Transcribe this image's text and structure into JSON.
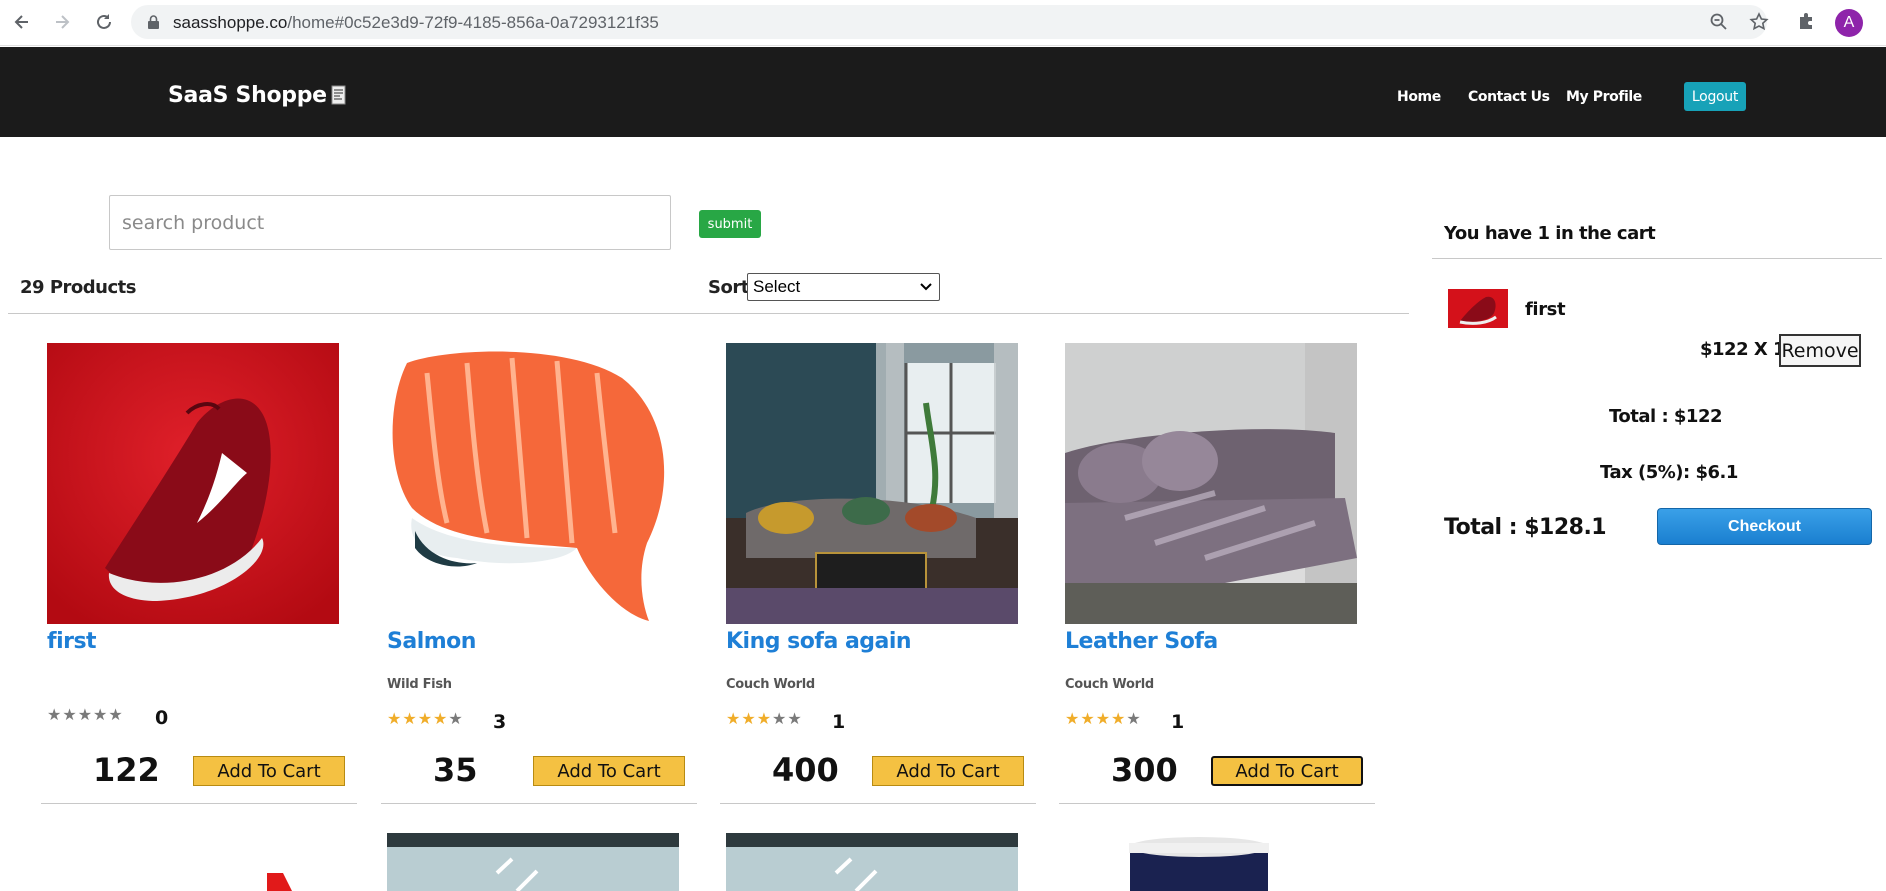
{
  "browser": {
    "url_host": "saasshoppe.co",
    "url_path": "/home#0c52e3d9-72f9-4185-856a-0a7293121f35",
    "avatar_letter": "A"
  },
  "header": {
    "brand": "SaaS Shoppe",
    "nav": [
      "Home",
      "Contact Us",
      "My Profile"
    ],
    "logout": "Logout"
  },
  "search": {
    "placeholder": "search product",
    "submit": "submit"
  },
  "listing": {
    "count_label": "29 Products",
    "sort_label": "Sort",
    "sort_value": "Select"
  },
  "products": [
    {
      "title": "first",
      "brand": "",
      "rating": 0,
      "rating_count": "0",
      "price": "122",
      "button": "Add To Cart"
    },
    {
      "title": "Salmon",
      "brand": "Wild Fish",
      "rating": 4,
      "rating_count": "3",
      "price": "35",
      "button": "Add To Cart"
    },
    {
      "title": "King sofa again",
      "brand": "Couch World",
      "rating": 3,
      "rating_count": "1",
      "price": "400",
      "button": "Add To Cart"
    },
    {
      "title": "Leather Sofa",
      "brand": "Couch World",
      "rating": 4,
      "rating_count": "1",
      "price": "300",
      "button": "Add To Cart"
    }
  ],
  "cart": {
    "title": "You have 1 in the cart",
    "item_name": "first",
    "item_qty": "$122 X 1",
    "remove": "Remove",
    "subtotal": "Total : $122",
    "tax": "Tax (5%): $6.1",
    "grand_total": "Total : $128.1",
    "checkout": "Checkout"
  }
}
